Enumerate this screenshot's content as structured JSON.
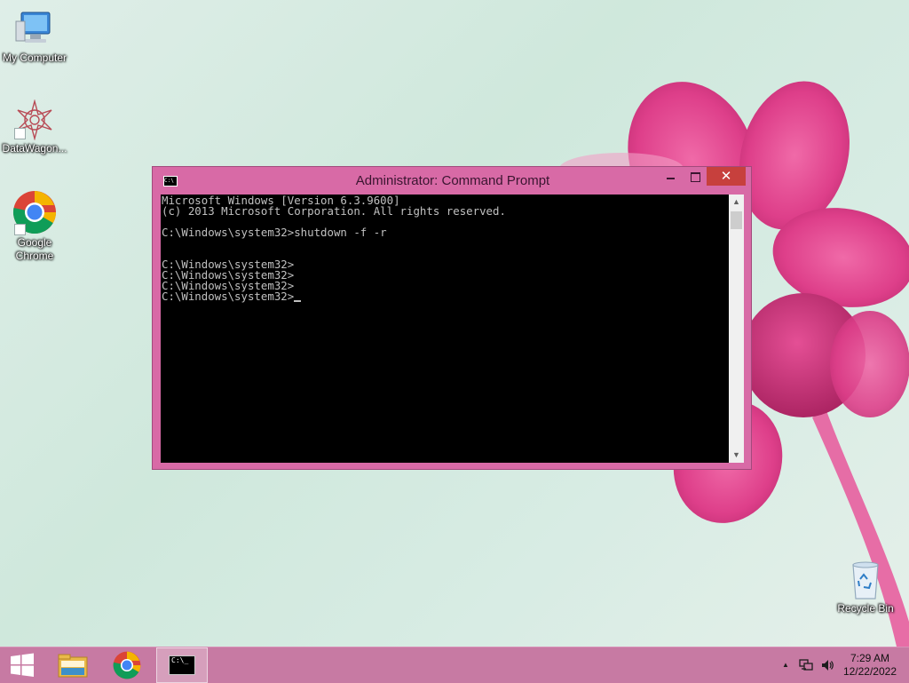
{
  "desktop": {
    "icons": [
      {
        "label": "My Computer",
        "icon": "my-computer-icon"
      },
      {
        "label": "DataWagon...",
        "icon": "datawagon-icon"
      },
      {
        "label": "Google\nChrome",
        "icon": "chrome-icon"
      },
      {
        "label": "Recycle Bin",
        "icon": "recycle-bin-icon"
      }
    ]
  },
  "window": {
    "title": "Administrator: Command Prompt",
    "icon_text": "C:\\",
    "controls": {
      "minimize": "minimize-icon",
      "maximize": "maximize-icon",
      "close": "✕"
    },
    "console_lines": [
      "Microsoft Windows [Version 6.3.9600]",
      "(c) 2013 Microsoft Corporation. All rights reserved.",
      "",
      "C:\\Windows\\system32>shutdown -f -r",
      "",
      "",
      "C:\\Windows\\system32>",
      "C:\\Windows\\system32>",
      "C:\\Windows\\system32>",
      "C:\\Windows\\system32>"
    ]
  },
  "taskbar": {
    "items": [
      "start-icon",
      "file-explorer-icon",
      "chrome-icon",
      "command-prompt-icon"
    ],
    "tray": {
      "show_hidden": "▲",
      "time": "7:29 AM",
      "date": "12/22/2022"
    }
  },
  "colors": {
    "window_frame": "#d86aa6",
    "taskbar": "#c77aa3",
    "close_button": "#c7403d"
  }
}
